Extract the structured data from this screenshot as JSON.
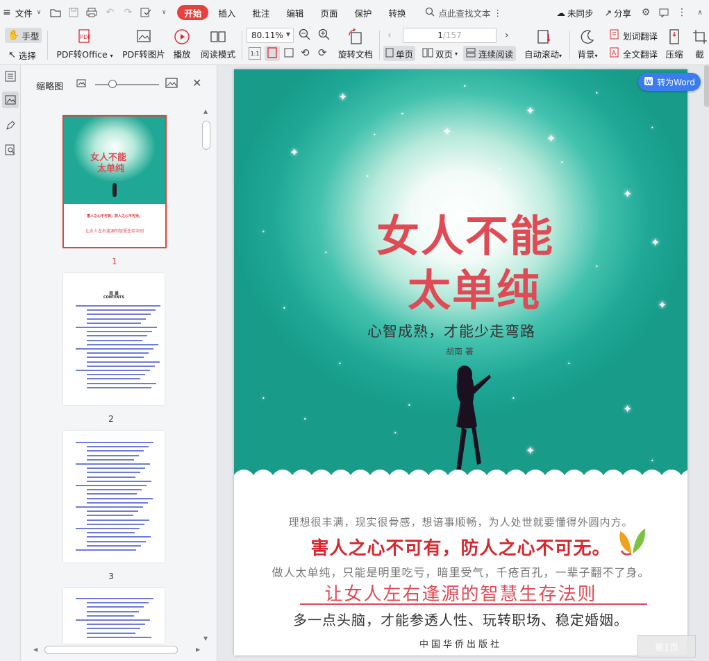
{
  "menubar": {
    "file": "文件",
    "tabs": [
      "开始",
      "插入",
      "批注",
      "编辑",
      "页面",
      "保护",
      "转换"
    ],
    "search": "点此查找文本",
    "sync": "未同步",
    "share": "分享"
  },
  "ribbon": {
    "hand": "手型",
    "select": "选择",
    "pdf_to_office": "PDF转Office",
    "pdf_to_image": "PDF转图片",
    "play": "播放",
    "read_mode": "阅读模式",
    "zoom": "80.11%",
    "rotate": "旋转文档",
    "page_current": "1",
    "page_total": "/157",
    "single": "单页",
    "double": "双页",
    "continuous": "连续阅读",
    "auto_scroll": "自动滚动",
    "background": "背景",
    "word_translate": "划词翻译",
    "full_translate": "全文翻译",
    "compress": "压缩",
    "crop": "截"
  },
  "thumbnails": {
    "title": "缩略图",
    "pages": [
      "1",
      "2",
      "3"
    ],
    "toc_heading": "目  录",
    "toc_heading_en": "CONTENTS"
  },
  "document": {
    "to_word": "转为Word",
    "page_badge": "第1页",
    "cover": {
      "title_line1": "女人不能",
      "title_line2": "太单纯",
      "subtitle": "心智成熟，才能少走弯路",
      "author": "胡南 著",
      "line1": "理想很丰满，现实很骨感，想谙事顺畅，为人处世就要懂得外圆内方。",
      "line2": "害人之心不可有，防人之心不可无。",
      "line3": "做人太单纯，只能是明里吃亏，暗里受气，千疮百孔，一辈子翻不了身。",
      "line4": "让女人左右逢源的智慧生存法则",
      "line5": "多一点头脑，才能参透人性、玩转职场、稳定婚姻。",
      "publisher": "中国华侨出版社"
    }
  },
  "colors": {
    "accent": "#e5423b",
    "cover_teal": "#1fa896",
    "title_red": "#e04a55",
    "word_button": "#3d7bf0"
  }
}
